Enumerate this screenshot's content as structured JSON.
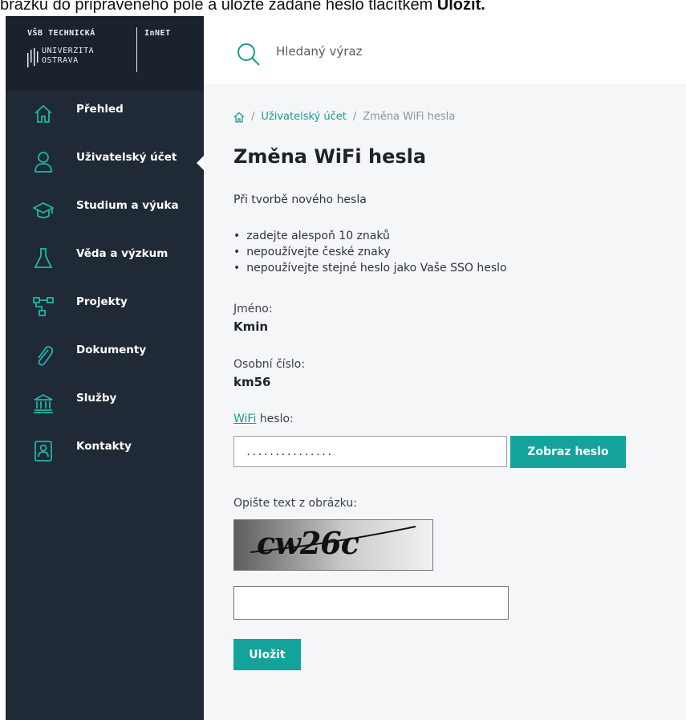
{
  "top_snippet": {
    "text": "brázku do připraveného pole a uložte zadané heslo tlačítkem ",
    "bold": "Uložit."
  },
  "logo": {
    "line1": "VŠB TECHNICKÁ",
    "line2": "UNIVERZITA",
    "line3": "OSTRAVA",
    "product": "InNET"
  },
  "sidebar": {
    "items": [
      {
        "label": "Přehled",
        "icon": "home-icon"
      },
      {
        "label": "Uživatelský účet",
        "icon": "user-icon",
        "active": true
      },
      {
        "label": "Studium a výuka",
        "icon": "graduation-cap-icon"
      },
      {
        "label": "Věda a výzkum",
        "icon": "flask-icon"
      },
      {
        "label": "Projekty",
        "icon": "project-tree-icon"
      },
      {
        "label": "Dokumenty",
        "icon": "paperclip-icon"
      },
      {
        "label": "Služby",
        "icon": "institution-icon"
      },
      {
        "label": "Kontakty",
        "icon": "contact-card-icon"
      }
    ]
  },
  "search": {
    "placeholder": "Hledaný výraz"
  },
  "breadcrumb": {
    "sep": "/",
    "link": "Uživatelský účet",
    "current": "Změna WiFi hesla"
  },
  "page": {
    "title": "Změna WiFi hesla",
    "intro": "Při tvorbě nového hesla",
    "rules": [
      "zadejte alespoň 10 znaků",
      "nepoužívejte české znaky",
      "nepoužívejte stejné heslo jako Vaše SSO heslo"
    ],
    "name_label": "Jméno:",
    "name_value": "Kmin",
    "personal_number_label": "Osobní číslo:",
    "personal_number_value": "km56",
    "wifi_link": "WiFi",
    "wifi_label_rest": " heslo:",
    "password_masked": "...............",
    "show_password_label": "Zobraz heslo",
    "captcha_label": "Opište text z obrázku:",
    "captcha_text": "cw26c",
    "save_label": "Uložit"
  },
  "colors": {
    "sidebar_bg": "#1f2a36",
    "accent": "#13a39a",
    "icon_accent": "#1fb5a8"
  }
}
